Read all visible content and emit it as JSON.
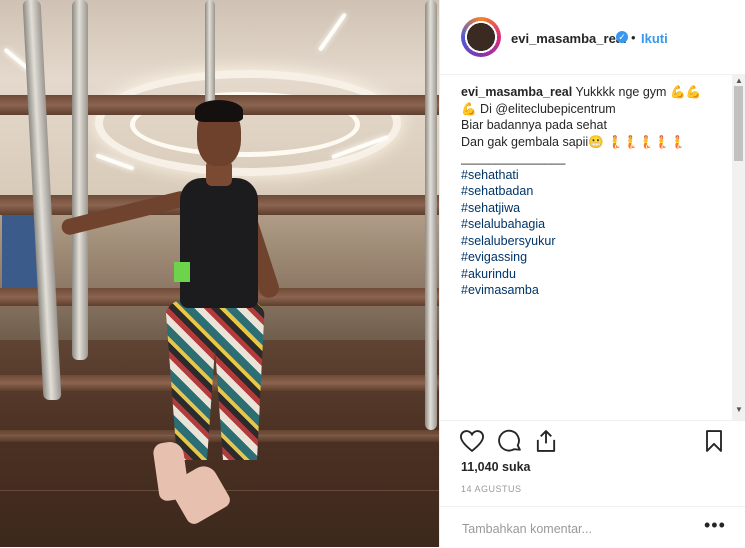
{
  "post": {
    "username": "evi_masamba_real",
    "follow_label": "Ikuti",
    "separator": "•",
    "verified_glyph": "✓",
    "caption_first": "Yukkkk nge gym 💪💪",
    "caption_lines": [
      "💪 Di @eliteclubepicentrum",
      "Biar badannya pada sehat",
      "Dan gak gembala sapii😬 🧜🧜🧜🧜🧜",
      "_______________"
    ],
    "hashtags": [
      "#sehathati",
      "#sehatbadan",
      "#sehatjiwa",
      "#selalubahagia",
      "#selalubersyukur",
      "#evigassing",
      "#akurindu",
      "#evimasamba"
    ],
    "likes": "11,040 suka",
    "date": "14 AGUSTUS",
    "comment_placeholder": "Tambahkan komentar...",
    "more_label": "•••"
  },
  "icons": [
    "heart-icon",
    "comment-icon",
    "share-icon",
    "bookmark-icon",
    "verified-badge-icon",
    "more-options-icon"
  ],
  "colors": {
    "accent": "#3897f0",
    "text": "#262626",
    "muted": "#999999",
    "tag": "#003569"
  }
}
